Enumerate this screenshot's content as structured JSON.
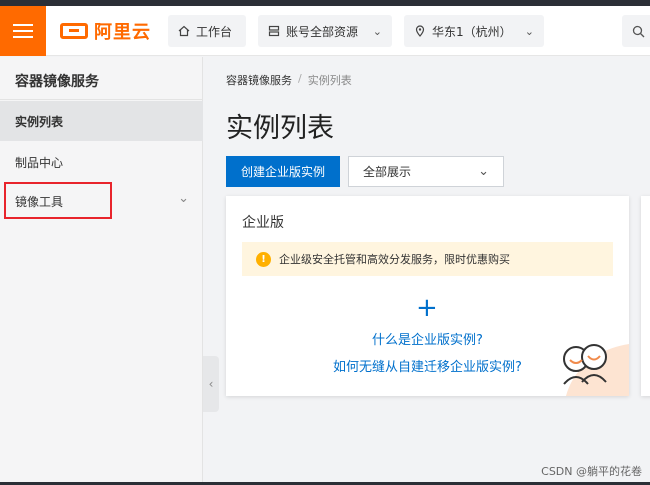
{
  "topbar": {
    "logo_text": "阿里云",
    "home_label": "工作台",
    "resources_label": "账号全部资源",
    "region_label": "华东1（杭州）"
  },
  "sidebar": {
    "title": "容器镜像服务",
    "items": [
      {
        "label": "实例列表",
        "active": true
      },
      {
        "label": "制品中心",
        "active": false
      },
      {
        "label": "镜像工具",
        "active": false,
        "expandable": true
      }
    ]
  },
  "breadcrumb": {
    "items": [
      "容器镜像服务",
      "实例列表"
    ],
    "separator": "/"
  },
  "main": {
    "title": "实例列表",
    "create_button": "创建企业版实例",
    "filter": {
      "selected": "全部展示"
    }
  },
  "card": {
    "title": "企业版",
    "notice": "企业级安全托管和高效分发服务，限时优惠购买",
    "add_symbol": "+",
    "link_what": "什么是企业版实例?",
    "link_migrate": "如何无缝从自建迁移企业版实例?"
  },
  "watermark": "CSDN @躺平的花卷",
  "colors": {
    "brand": "#ff6a00",
    "primary": "#0070cc",
    "highlight_box": "#e8242c",
    "notice_bg": "#fff5df",
    "warning": "#ffb000"
  }
}
